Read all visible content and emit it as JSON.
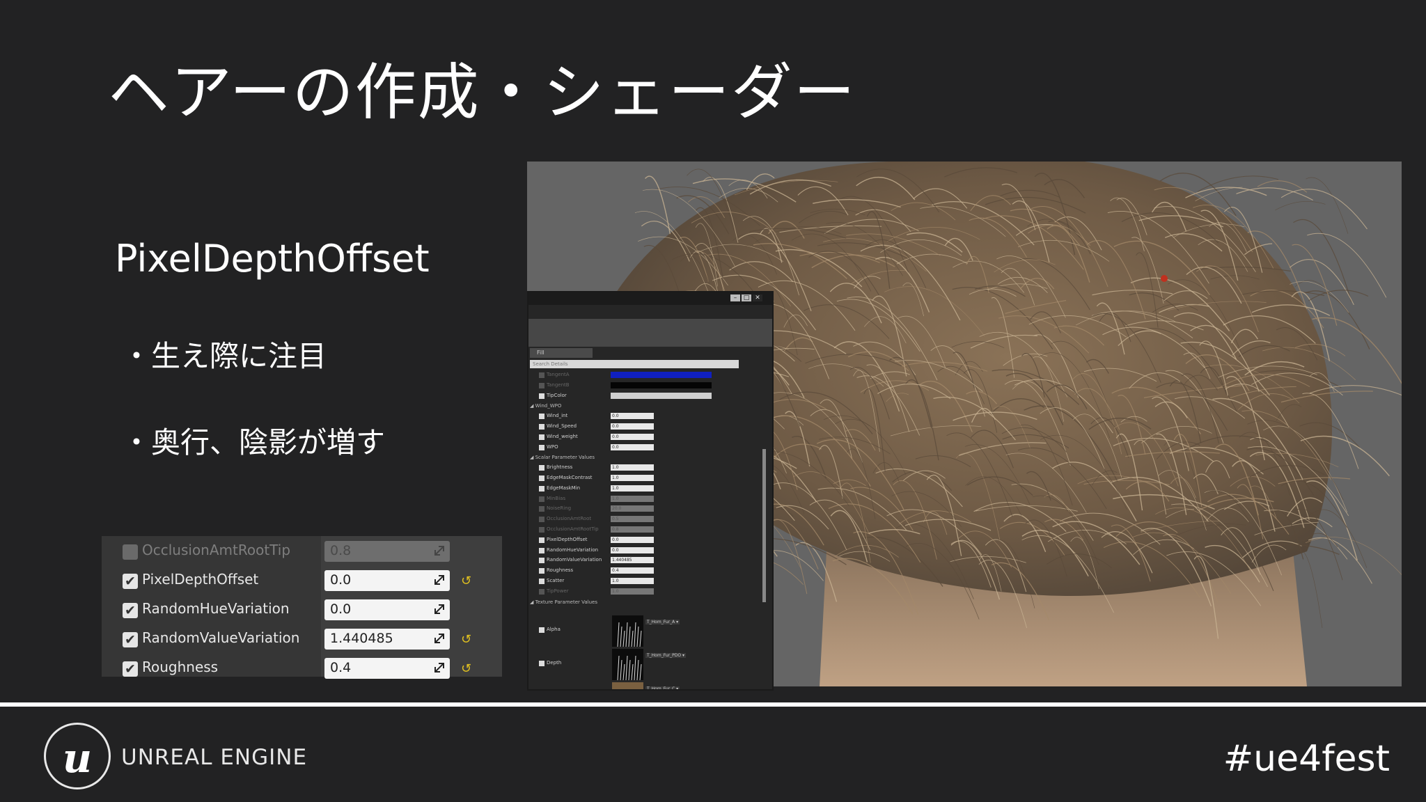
{
  "slide": {
    "title": "ヘアーの作成・シェーダー",
    "subtitle": "PixelDepthOffset",
    "bullets": [
      "・生え際に注目",
      "・奥行、陰影が増す"
    ]
  },
  "zoom_details": {
    "rows": [
      {
        "label": "OcclusionAmtRootTip",
        "value": "0.8",
        "enabled": false,
        "reset": false
      },
      {
        "label": "PixelDepthOffset",
        "value": "0.0",
        "enabled": true,
        "reset": true
      },
      {
        "label": "RandomHueVariation",
        "value": "0.0",
        "enabled": true,
        "reset": false
      },
      {
        "label": "RandomValueVariation",
        "value": "1.440485",
        "enabled": true,
        "reset": true
      },
      {
        "label": "Roughness",
        "value": "0.4",
        "enabled": true,
        "reset": true
      }
    ]
  },
  "editor": {
    "tab": "Fill",
    "search_placeholder": "Search Details",
    "rows": [
      {
        "type": "row",
        "label": "TangentA",
        "value": "",
        "enabled": false
      },
      {
        "type": "row",
        "label": "TangentB",
        "value": "",
        "enabled": false
      },
      {
        "type": "row",
        "label": "TipColor",
        "value": "",
        "enabled": true
      },
      {
        "type": "cat",
        "label": "◢ Wind_WPO"
      },
      {
        "type": "row",
        "label": "Wind_int",
        "value": "0.0",
        "enabled": true
      },
      {
        "type": "row",
        "label": "Wind_Speed",
        "value": "0.0",
        "enabled": true
      },
      {
        "type": "row",
        "label": "Wind_weight",
        "value": "0.0",
        "enabled": true
      },
      {
        "type": "row",
        "label": "WPO",
        "value": "0.0",
        "enabled": true
      },
      {
        "type": "cat",
        "label": "◢ Scalar Parameter Values"
      },
      {
        "type": "row",
        "label": "Brightness",
        "value": "1.0",
        "enabled": true
      },
      {
        "type": "row",
        "label": "EdgeMaskContrast",
        "value": "1.0",
        "enabled": true
      },
      {
        "type": "row",
        "label": "EdgeMaskMin",
        "value": "1.0",
        "enabled": true
      },
      {
        "type": "row",
        "label": "MinBias",
        "value": "1.0",
        "enabled": false
      },
      {
        "type": "row",
        "label": "NoiseRing",
        "value": "20.0",
        "enabled": false
      },
      {
        "type": "row",
        "label": "OcclusionAmtRoot",
        "value": "0.5",
        "enabled": false
      },
      {
        "type": "row",
        "label": "OcclusionAmtRootTip",
        "value": "0.8",
        "enabled": false
      },
      {
        "type": "row",
        "label": "PixelDepthOffset",
        "value": "0.0",
        "enabled": true
      },
      {
        "type": "row",
        "label": "RandomHueVariation",
        "value": "0.0",
        "enabled": true
      },
      {
        "type": "row",
        "label": "RandomValueVariation",
        "value": "1.440485",
        "enabled": true
      },
      {
        "type": "row",
        "label": "Roughness",
        "value": "0.4",
        "enabled": true
      },
      {
        "type": "row",
        "label": "Scatter",
        "value": "1.0",
        "enabled": true
      },
      {
        "type": "row",
        "label": "TipPower",
        "value": "1.0",
        "enabled": false
      },
      {
        "type": "cat",
        "label": "◢ Texture Parameter Values"
      }
    ],
    "textures": [
      {
        "label": "Alpha",
        "asset": "T_Hom_Fur_A ▾"
      },
      {
        "label": "Depth",
        "asset": "T_Hom_Fur_PDO ▾"
      },
      {
        "label": "",
        "asset": "T_Hom_Fur_C ▾"
      }
    ]
  },
  "footer": {
    "brand": "UNREAL ENGINE",
    "logo_letter": "u",
    "hashtag": "#ue4fest"
  },
  "colors": {
    "background": "#222223",
    "reset_arrow": "#e0c020",
    "viewport_bg": "#656565"
  }
}
